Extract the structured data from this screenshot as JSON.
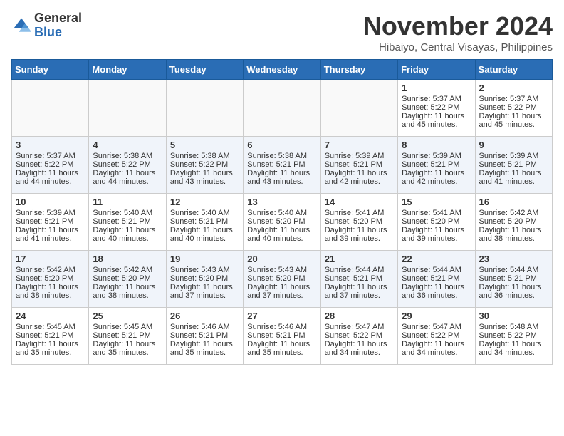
{
  "header": {
    "logo_general": "General",
    "logo_blue": "Blue",
    "month_title": "November 2024",
    "location": "Hibaiyo, Central Visayas, Philippines"
  },
  "days_of_week": [
    "Sunday",
    "Monday",
    "Tuesday",
    "Wednesday",
    "Thursday",
    "Friday",
    "Saturday"
  ],
  "weeks": [
    [
      {
        "day": "",
        "info": ""
      },
      {
        "day": "",
        "info": ""
      },
      {
        "day": "",
        "info": ""
      },
      {
        "day": "",
        "info": ""
      },
      {
        "day": "",
        "info": ""
      },
      {
        "day": "1",
        "info": "Sunrise: 5:37 AM\nSunset: 5:22 PM\nDaylight: 11 hours and 45 minutes."
      },
      {
        "day": "2",
        "info": "Sunrise: 5:37 AM\nSunset: 5:22 PM\nDaylight: 11 hours and 45 minutes."
      }
    ],
    [
      {
        "day": "3",
        "info": "Sunrise: 5:37 AM\nSunset: 5:22 PM\nDaylight: 11 hours and 44 minutes."
      },
      {
        "day": "4",
        "info": "Sunrise: 5:38 AM\nSunset: 5:22 PM\nDaylight: 11 hours and 44 minutes."
      },
      {
        "day": "5",
        "info": "Sunrise: 5:38 AM\nSunset: 5:22 PM\nDaylight: 11 hours and 43 minutes."
      },
      {
        "day": "6",
        "info": "Sunrise: 5:38 AM\nSunset: 5:21 PM\nDaylight: 11 hours and 43 minutes."
      },
      {
        "day": "7",
        "info": "Sunrise: 5:39 AM\nSunset: 5:21 PM\nDaylight: 11 hours and 42 minutes."
      },
      {
        "day": "8",
        "info": "Sunrise: 5:39 AM\nSunset: 5:21 PM\nDaylight: 11 hours and 42 minutes."
      },
      {
        "day": "9",
        "info": "Sunrise: 5:39 AM\nSunset: 5:21 PM\nDaylight: 11 hours and 41 minutes."
      }
    ],
    [
      {
        "day": "10",
        "info": "Sunrise: 5:39 AM\nSunset: 5:21 PM\nDaylight: 11 hours and 41 minutes."
      },
      {
        "day": "11",
        "info": "Sunrise: 5:40 AM\nSunset: 5:21 PM\nDaylight: 11 hours and 40 minutes."
      },
      {
        "day": "12",
        "info": "Sunrise: 5:40 AM\nSunset: 5:21 PM\nDaylight: 11 hours and 40 minutes."
      },
      {
        "day": "13",
        "info": "Sunrise: 5:40 AM\nSunset: 5:20 PM\nDaylight: 11 hours and 40 minutes."
      },
      {
        "day": "14",
        "info": "Sunrise: 5:41 AM\nSunset: 5:20 PM\nDaylight: 11 hours and 39 minutes."
      },
      {
        "day": "15",
        "info": "Sunrise: 5:41 AM\nSunset: 5:20 PM\nDaylight: 11 hours and 39 minutes."
      },
      {
        "day": "16",
        "info": "Sunrise: 5:42 AM\nSunset: 5:20 PM\nDaylight: 11 hours and 38 minutes."
      }
    ],
    [
      {
        "day": "17",
        "info": "Sunrise: 5:42 AM\nSunset: 5:20 PM\nDaylight: 11 hours and 38 minutes."
      },
      {
        "day": "18",
        "info": "Sunrise: 5:42 AM\nSunset: 5:20 PM\nDaylight: 11 hours and 38 minutes."
      },
      {
        "day": "19",
        "info": "Sunrise: 5:43 AM\nSunset: 5:20 PM\nDaylight: 11 hours and 37 minutes."
      },
      {
        "day": "20",
        "info": "Sunrise: 5:43 AM\nSunset: 5:20 PM\nDaylight: 11 hours and 37 minutes."
      },
      {
        "day": "21",
        "info": "Sunrise: 5:44 AM\nSunset: 5:21 PM\nDaylight: 11 hours and 37 minutes."
      },
      {
        "day": "22",
        "info": "Sunrise: 5:44 AM\nSunset: 5:21 PM\nDaylight: 11 hours and 36 minutes."
      },
      {
        "day": "23",
        "info": "Sunrise: 5:44 AM\nSunset: 5:21 PM\nDaylight: 11 hours and 36 minutes."
      }
    ],
    [
      {
        "day": "24",
        "info": "Sunrise: 5:45 AM\nSunset: 5:21 PM\nDaylight: 11 hours and 35 minutes."
      },
      {
        "day": "25",
        "info": "Sunrise: 5:45 AM\nSunset: 5:21 PM\nDaylight: 11 hours and 35 minutes."
      },
      {
        "day": "26",
        "info": "Sunrise: 5:46 AM\nSunset: 5:21 PM\nDaylight: 11 hours and 35 minutes."
      },
      {
        "day": "27",
        "info": "Sunrise: 5:46 AM\nSunset: 5:21 PM\nDaylight: 11 hours and 35 minutes."
      },
      {
        "day": "28",
        "info": "Sunrise: 5:47 AM\nSunset: 5:22 PM\nDaylight: 11 hours and 34 minutes."
      },
      {
        "day": "29",
        "info": "Sunrise: 5:47 AM\nSunset: 5:22 PM\nDaylight: 11 hours and 34 minutes."
      },
      {
        "day": "30",
        "info": "Sunrise: 5:48 AM\nSunset: 5:22 PM\nDaylight: 11 hours and 34 minutes."
      }
    ]
  ]
}
